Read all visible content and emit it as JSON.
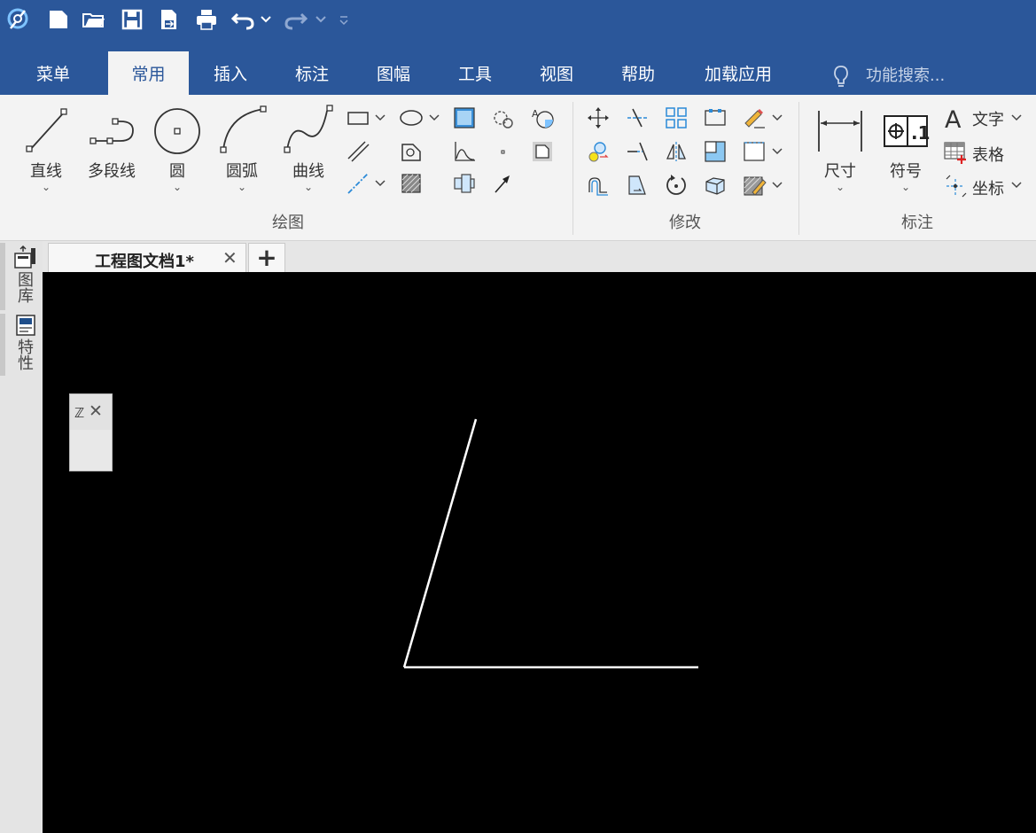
{
  "title_bar": {
    "quick_access": [
      "app-logo-icon",
      "new-file-icon",
      "open-folder-icon",
      "save-icon",
      "save-as-icon",
      "print-icon",
      "undo-icon",
      "redo-icon",
      "customize-icon"
    ]
  },
  "ribbon_tabs": [
    {
      "label": "菜单",
      "active": false
    },
    {
      "label": "常用",
      "active": true
    },
    {
      "label": "插入",
      "active": false
    },
    {
      "label": "标注",
      "active": false
    },
    {
      "label": "图幅",
      "active": false
    },
    {
      "label": "工具",
      "active": false
    },
    {
      "label": "视图",
      "active": false
    },
    {
      "label": "帮助",
      "active": false
    },
    {
      "label": "加载应用",
      "active": false
    }
  ],
  "search": {
    "placeholder": "功能搜索..."
  },
  "groups": {
    "draw": {
      "label": "绘图",
      "buttons": [
        {
          "label": "直线"
        },
        {
          "label": "多段线"
        },
        {
          "label": "圆"
        },
        {
          "label": "圆弧"
        },
        {
          "label": "曲线"
        }
      ]
    },
    "modify": {
      "label": "修改"
    },
    "annotate": {
      "label": "标注",
      "buttons": [
        {
          "label": "尺寸"
        },
        {
          "label": "符号"
        }
      ],
      "small": [
        {
          "label": "文字"
        },
        {
          "label": "表格"
        },
        {
          "label": "坐标"
        }
      ]
    }
  },
  "left_panel": {
    "items": [
      {
        "label": "图库"
      },
      {
        "label": "特性"
      }
    ]
  },
  "doc_tab": {
    "title": "工程图文档1*",
    "close": "✕",
    "add": "+"
  },
  "float_panel": {
    "title": "ℤ",
    "close": "✕"
  },
  "colors": {
    "titlebar": "#2b579a",
    "ribbon": "#f3f3f3",
    "canvas": "#000000",
    "line": "#ffffff"
  }
}
